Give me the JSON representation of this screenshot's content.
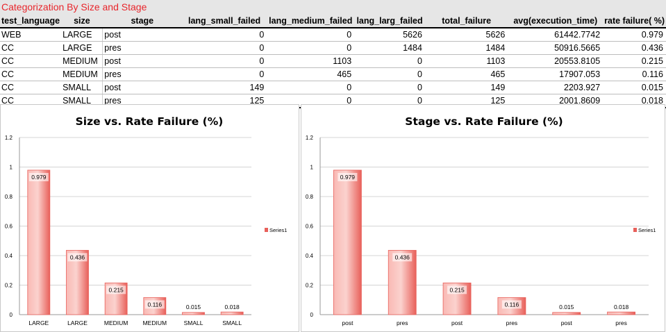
{
  "sheet": {
    "title": "Categorization By  Size and Stage",
    "columns": [
      "test_language",
      "size",
      "stage",
      "lang_small_failed",
      "lang_medium_failed",
      "lang_larg_failed",
      "total_failure",
      "avg(execution_time)",
      "rate failure( %)"
    ],
    "rows": [
      [
        "WEB",
        "LARGE",
        "post",
        "0",
        "0",
        "5626",
        "5626",
        "61442.7742",
        "0.979"
      ],
      [
        "CC",
        "LARGE",
        "pres",
        "0",
        "0",
        "1484",
        "1484",
        "50916.5665",
        "0.436"
      ],
      [
        "CC",
        "MEDIUM",
        "post",
        "0",
        "1103",
        "0",
        "1103",
        "20553.8105",
        "0.215"
      ],
      [
        "CC",
        "MEDIUM",
        "pres",
        "0",
        "465",
        "0",
        "465",
        "17907.053",
        "0.116"
      ],
      [
        "CC",
        "SMALL",
        "post",
        "149",
        "0",
        "0",
        "149",
        "2203.927",
        "0.015"
      ],
      [
        "CC",
        "SMALL",
        "pres",
        "125",
        "0",
        "0",
        "125",
        "2001.8609",
        "0.018"
      ]
    ]
  },
  "chart_data": [
    {
      "type": "bar",
      "title": "Size vs. Rate Failure (%)",
      "categories": [
        "LARGE",
        "LARGE",
        "MEDIUM",
        "MEDIUM",
        "SMALL",
        "SMALL"
      ],
      "series": [
        {
          "name": "Series1",
          "values": [
            0.979,
            0.436,
            0.215,
            0.116,
            0.015,
            0.018
          ]
        }
      ],
      "value_labels": [
        "0.979",
        "0.436",
        "0.215",
        "0.116",
        "0.015",
        "0.018"
      ],
      "xlabel": "",
      "ylabel": "",
      "ylim": [
        0,
        1.2
      ],
      "yticks": [
        "0",
        "0.2",
        "0.4",
        "0.6",
        "0.8",
        "1",
        "1.2"
      ],
      "grid": true,
      "legend": "right",
      "color": "#e8605a"
    },
    {
      "type": "bar",
      "title": "Stage vs. Rate Failure (%)",
      "categories": [
        "post",
        "pres",
        "post",
        "pres",
        "post",
        "pres"
      ],
      "series": [
        {
          "name": "Series1",
          "values": [
            0.979,
            0.436,
            0.215,
            0.116,
            0.015,
            0.018
          ]
        }
      ],
      "value_labels": [
        "0.979",
        "0.436",
        "0.215",
        "0.116",
        "0.015",
        "0.018"
      ],
      "xlabel": "",
      "ylabel": "",
      "ylim": [
        0,
        1.2
      ],
      "yticks": [
        "0",
        "0.2",
        "0.4",
        "0.6",
        "0.8",
        "1",
        "1.2"
      ],
      "grid": true,
      "legend": "right",
      "color": "#e8605a"
    }
  ]
}
